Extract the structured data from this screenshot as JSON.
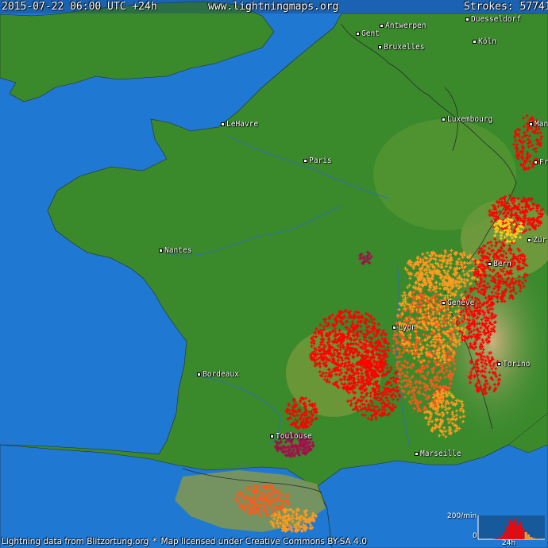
{
  "header": {
    "timestamp": "2015-07-22 06:00 UTC +24h",
    "site": "www.lightningmaps.org",
    "strokes_label": "Strokes:",
    "strokes_count": "57741"
  },
  "cities": [
    {
      "id": "gent",
      "name": "Gent"
    },
    {
      "id": "antwerpen",
      "name": "Antwerpen"
    },
    {
      "id": "bruxelles",
      "name": "Bruxelles"
    },
    {
      "id": "koeln",
      "name": "Köln"
    },
    {
      "id": "duesseldorf",
      "name": "Duesseldorf"
    },
    {
      "id": "luxembourg",
      "name": "Luxembourg"
    },
    {
      "id": "lehavre",
      "name": "LeHavre"
    },
    {
      "id": "paris",
      "name": "Paris"
    },
    {
      "id": "nantes",
      "name": "Nantes"
    },
    {
      "id": "lyon",
      "name": "Lyon"
    },
    {
      "id": "geneve",
      "name": "Genève"
    },
    {
      "id": "bern",
      "name": "Bern"
    },
    {
      "id": "zurich",
      "name": "Zür"
    },
    {
      "id": "frank",
      "name": "Fr"
    },
    {
      "id": "mann",
      "name": "Man"
    },
    {
      "id": "bordeaux",
      "name": "Bordeaux"
    },
    {
      "id": "toulouse",
      "name": "Toulouse"
    },
    {
      "id": "marseille",
      "name": "Marseille"
    },
    {
      "id": "torino",
      "name": "Torino"
    }
  ],
  "footer": {
    "credit": "Lightning data from Blitzortung.org",
    "separator": "*",
    "license": "Map licensed under Creative Commons BY-SA 4.0"
  },
  "histogram": {
    "max_label": "200/min",
    "min_label": "0",
    "time_label": "24h",
    "bars_per_min": [
      0,
      0,
      0,
      0,
      0,
      2,
      5,
      12,
      30,
      60,
      110,
      160,
      140,
      175,
      120,
      150,
      90,
      60,
      40,
      20,
      10,
      5,
      2,
      1
    ]
  },
  "colors": {
    "sea": "#1f78d1",
    "land": "#3a8a2c",
    "land_dark": "#2f7a25",
    "highland": "#7a9a3a",
    "mountain": "#b79a6a",
    "border": "#2a2a2a",
    "strike_old": "#ff0000",
    "strike_mid": "#ff5a1a",
    "strike_new": "#ff9a20",
    "strike_recent": "#ffd020",
    "strike_hot": "#a0104a"
  },
  "icons": {
    "city_marker": "square-dot-icon"
  }
}
